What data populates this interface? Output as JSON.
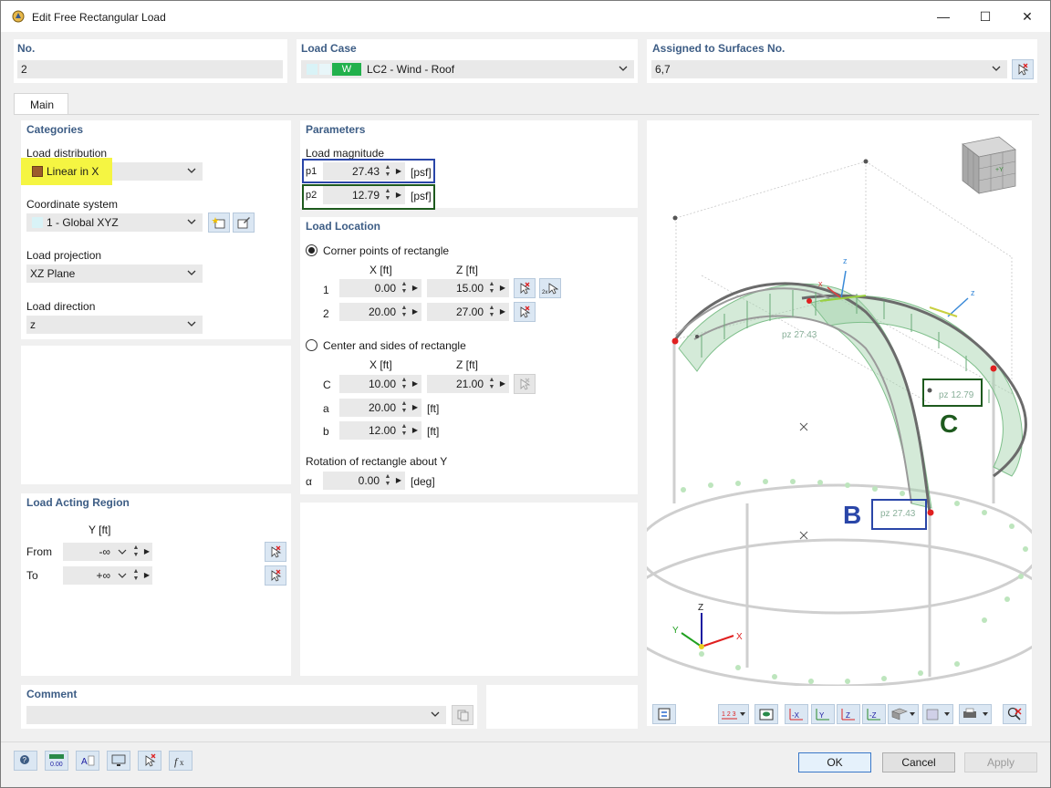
{
  "window": {
    "title": "Edit Free Rectangular Load",
    "minimize": "—",
    "maximize": "☐",
    "close": "✕"
  },
  "top": {
    "no_label": "No.",
    "no_value": "2",
    "load_case_label": "Load Case",
    "load_case_tag": "W",
    "load_case_value": "LC2 - Wind - Roof",
    "surfaces_label": "Assigned to Surfaces No.",
    "surfaces_value": "6,7"
  },
  "tabs": [
    {
      "label": "Main"
    }
  ],
  "categories": {
    "header": "Categories",
    "load_distribution_label": "Load distribution",
    "load_distribution_value": "Linear in X",
    "coordinate_system_label": "Coordinate system",
    "coordinate_system_value": "1 - Global XYZ",
    "load_projection_label": "Load projection",
    "load_projection_value": "XZ Plane",
    "load_direction_label": "Load direction",
    "load_direction_value": "z"
  },
  "parameters": {
    "header": "Parameters",
    "magnitude_label": "Load magnitude",
    "p1_label": "p1",
    "p1_value": "27.43",
    "p1_unit": "[psf]",
    "p2_label": "p2",
    "p2_value": "12.79",
    "p2_unit": "[psf]"
  },
  "location": {
    "header": "Load Location",
    "corner_option": "Corner points of rectangle",
    "x_head": "X [ft]",
    "z_head": "Z [ft]",
    "rows": [
      {
        "label": "1",
        "x": "0.00",
        "z": "15.00"
      },
      {
        "label": "2",
        "x": "20.00",
        "z": "27.00"
      }
    ],
    "center_option": "Center and sides of rectangle",
    "x_head2": "X [ft]",
    "z_head2": "Z [ft]",
    "c_label": "C",
    "c_x": "10.00",
    "c_z": "21.00",
    "a_label": "a",
    "a_value": "20.00",
    "a_unit": "[ft]",
    "b_label": "b",
    "b_value": "12.00",
    "b_unit": "[ft]",
    "rotation_label": "Rotation of rectangle about Y",
    "alpha_label": "α",
    "alpha_value": "0.00",
    "alpha_unit": "[deg]"
  },
  "acting_region": {
    "header": "Load Acting Region",
    "y_head": "Y [ft]",
    "from_label": "From",
    "from_value": "-∞",
    "to_label": "To",
    "to_value": "+∞"
  },
  "comment": {
    "header": "Comment",
    "value": ""
  },
  "view": {
    "annotation_b": "B",
    "annotation_c": "C",
    "pz_b": "pz 27.43",
    "pz_c": "pz 12.79",
    "pz_top": "pz 27.43",
    "axis_x": "X",
    "axis_y": "Y",
    "axis_z": "Z",
    "local_x": "x",
    "local_z1": "z",
    "local_z2": "z"
  },
  "footer": {
    "ok": "OK",
    "cancel": "Cancel",
    "apply": "Apply"
  },
  "colors": {
    "accent": "#3d5d85",
    "blue_box": "#2a46a8",
    "green_box": "#1e5a1e",
    "highlight": "#f5f542",
    "load_tag": "#22b14c"
  }
}
